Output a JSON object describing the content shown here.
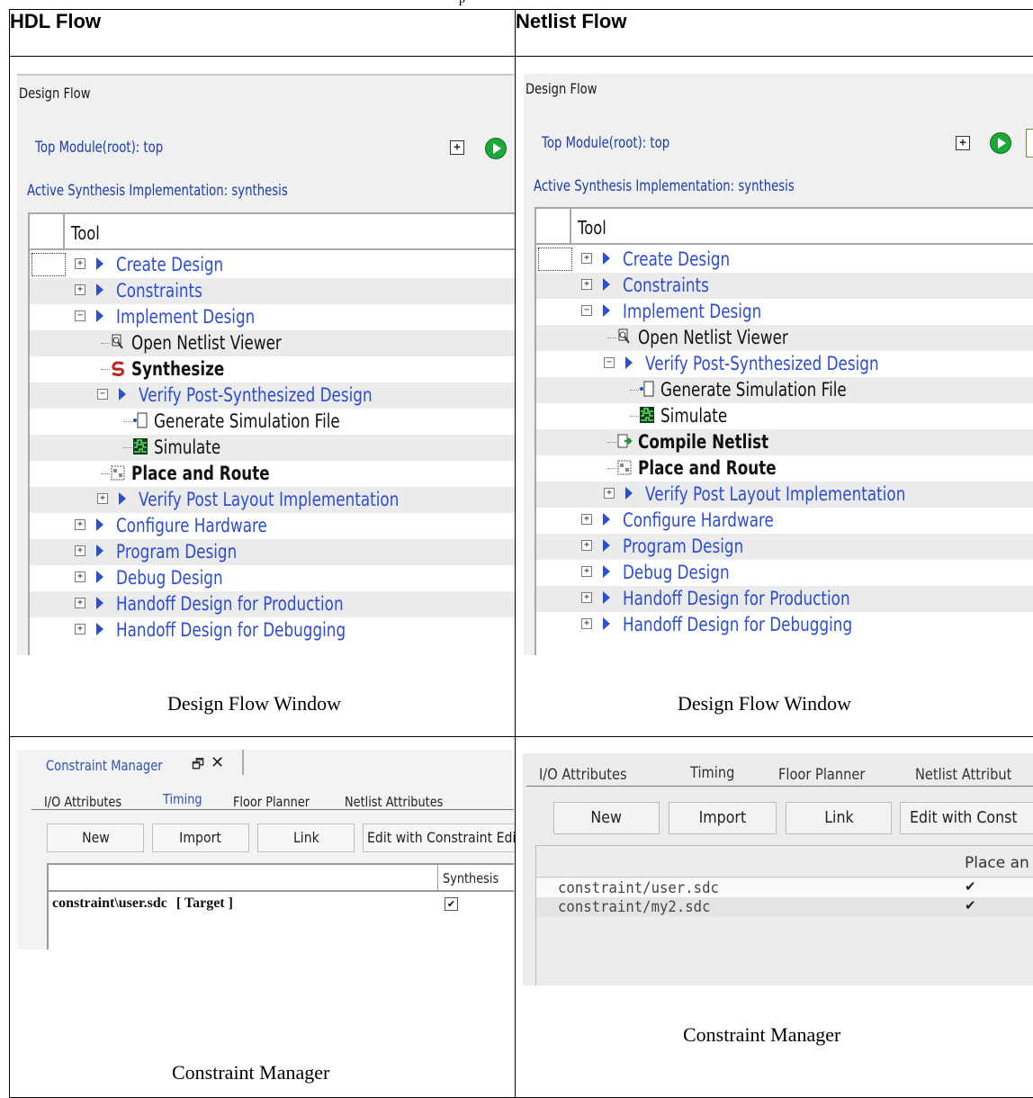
{
  "hdl_header": "HDL Flow",
  "netlist_header": "Netlist Flow",
  "design_flow": {
    "panel_title": "Design Flow",
    "top_module": "Top Module(root): top",
    "active_synthesis": "Active Synthesis Implementation: synthesis",
    "column_tool": "Tool",
    "caption": "Design Flow Window"
  },
  "hdl_tree": [
    {
      "label": "Create Design",
      "pm": "+"
    },
    {
      "label": "Constraints",
      "pm": "+"
    },
    {
      "label": "Implement Design",
      "pm": "-"
    },
    {
      "label": "Open Netlist Viewer",
      "icon": "netlist-viewer-icon"
    },
    {
      "label": "Synthesize",
      "icon": "synthesize-icon"
    },
    {
      "label": "Verify Post-Synthesized Design",
      "pm": "-"
    },
    {
      "label": "Generate Simulation File",
      "icon": "document-icon"
    },
    {
      "label": "Simulate",
      "icon": "waveform-icon"
    },
    {
      "label": "Place and Route",
      "icon": "place-route-icon"
    },
    {
      "label": "Verify Post Layout Implementation",
      "pm": "+"
    },
    {
      "label": "Configure Hardware",
      "pm": "+"
    },
    {
      "label": "Program Design",
      "pm": "+"
    },
    {
      "label": "Debug Design",
      "pm": "+"
    },
    {
      "label": "Handoff Design for Production",
      "pm": "+"
    },
    {
      "label": "Handoff Design for Debugging",
      "pm": "+"
    }
  ],
  "netlist_tree": [
    {
      "label": "Create Design",
      "pm": "+"
    },
    {
      "label": "Constraints",
      "pm": "+"
    },
    {
      "label": "Implement Design",
      "pm": "-"
    },
    {
      "label": "Open Netlist Viewer",
      "icon": "netlist-viewer-icon"
    },
    {
      "label": "Verify Post-Synthesized Design",
      "pm": "-"
    },
    {
      "label": "Generate Simulation File",
      "icon": "document-icon"
    },
    {
      "label": "Simulate",
      "icon": "waveform-icon"
    },
    {
      "label": "Compile Netlist",
      "icon": "compile-icon"
    },
    {
      "label": "Place and Route",
      "icon": "place-route-icon"
    },
    {
      "label": "Verify Post Layout Implementation",
      "pm": "+"
    },
    {
      "label": "Configure Hardware",
      "pm": "+"
    },
    {
      "label": "Program Design",
      "pm": "+"
    },
    {
      "label": "Debug Design",
      "pm": "+"
    },
    {
      "label": "Handoff Design for Production",
      "pm": "+"
    },
    {
      "label": "Handoff Design for Debugging",
      "pm": "+"
    }
  ],
  "cm_left": {
    "title": "Constraint Manager",
    "tabs": [
      "I/O Attributes",
      "Timing",
      "Floor Planner",
      "Netlist Attributes"
    ],
    "buttons": [
      "New",
      "Import",
      "Link",
      "Edit with Constraint Edi"
    ],
    "column": "Synthesis",
    "row_file": "constraint\\user.sdc",
    "row_target": "[ Target ]",
    "checkmark": "✔",
    "caption": "Constraint Manager"
  },
  "cm_right": {
    "tabs": [
      "I/O Attributes",
      "Timing",
      "Floor Planner",
      "Netlist Attribut"
    ],
    "buttons": [
      "New",
      "Import",
      "Link",
      "Edit with Const"
    ],
    "column": "Place an",
    "rows": [
      "constraint/user.sdc",
      "constraint/my2.sdc"
    ],
    "checkmark": "✔",
    "caption": "Constraint Manager"
  },
  "top_cut_text": "p"
}
